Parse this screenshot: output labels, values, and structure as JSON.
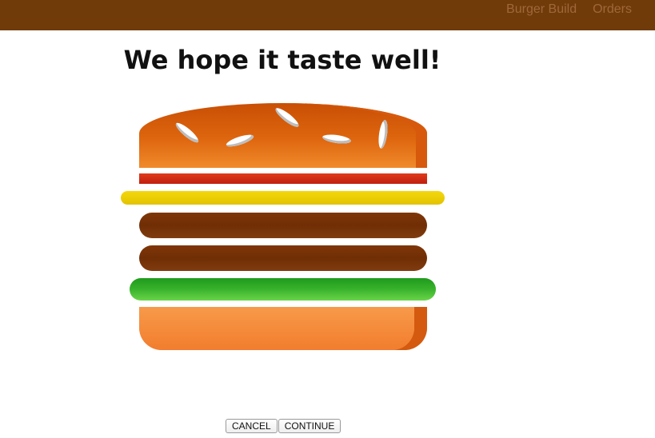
{
  "header": {
    "nav": [
      {
        "label": "Burger Build"
      },
      {
        "label": "Orders"
      }
    ],
    "background_color": "#703B09"
  },
  "main": {
    "title": "We hope it taste well!",
    "burger": {
      "ingredients": [
        "bread-top",
        "bacon",
        "cheese",
        "meat",
        "meat",
        "salad",
        "bread-bottom"
      ]
    },
    "buttons": {
      "cancel_label": "CANCEL",
      "continue_label": "CONTINUE"
    }
  }
}
